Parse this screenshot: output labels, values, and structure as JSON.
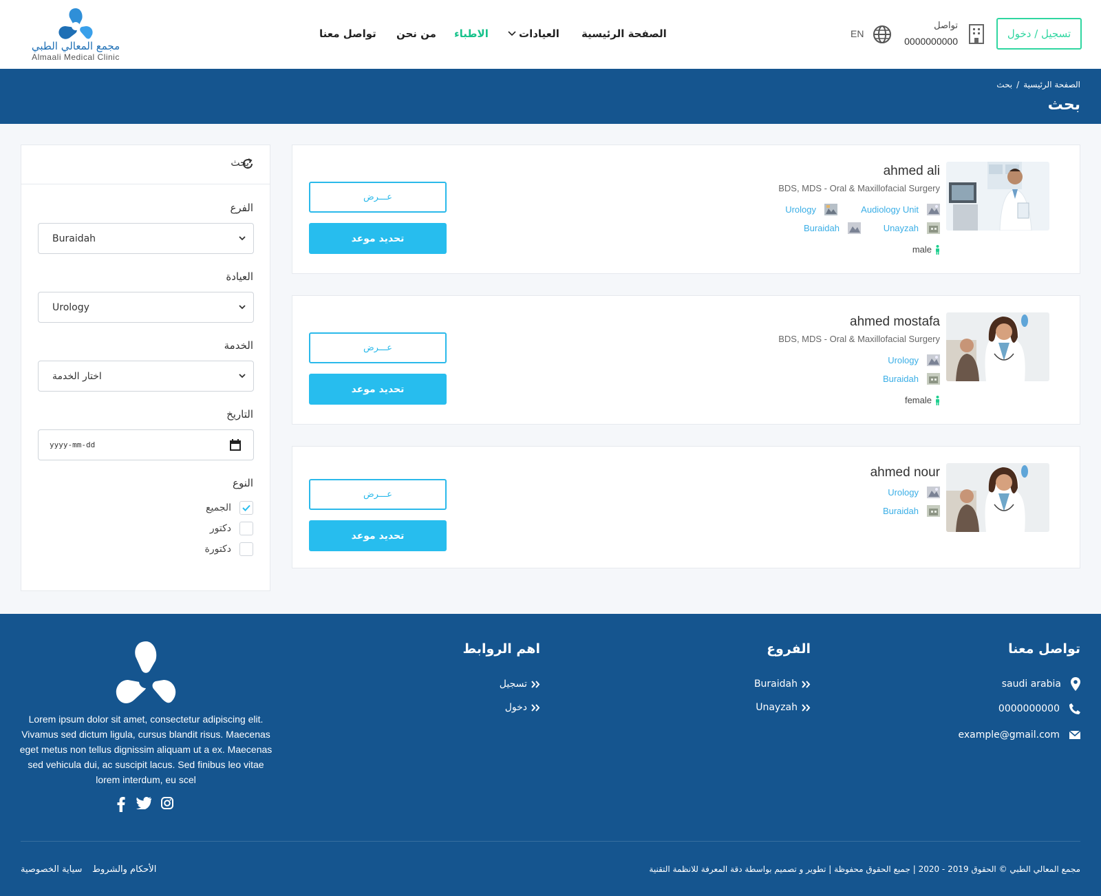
{
  "header": {
    "logo_ar": "مجمع المعالي الطبي",
    "logo_en": "Almaali Medical Clinic",
    "nav": [
      {
        "label": "الصفحة الرئيسية",
        "active": false
      },
      {
        "label": "العيادات",
        "active": false
      },
      {
        "label": "الاطباء",
        "active": true
      },
      {
        "label": "من نحن",
        "active": false
      },
      {
        "label": "تواصل معنا",
        "active": false
      }
    ],
    "login_label": "تسجيل / دخول",
    "contact_label": "تواصل",
    "contact_phone": "0000000000",
    "lang_label": "EN",
    "accent_color": "#2fd6a0",
    "active_nav_color": "#16c28b"
  },
  "banner": {
    "breadcrumb_home": "الصفحة الرئيسية",
    "breadcrumb_sep": "/",
    "breadcrumb_current": "بحث",
    "title": "بحث",
    "color": "#15558f"
  },
  "sidebar": {
    "title": "بحث",
    "branch_label": "الفرع",
    "branch_value": "Buraidah",
    "clinic_label": "العيادة",
    "clinic_value": "Urology",
    "service_label": "الخدمة",
    "service_value": "اختار الخدمة",
    "date_label": "التاريخ",
    "date_placeholder": "yyyy-mm-dd",
    "type_label": "النوع",
    "type_options": [
      {
        "label": "الجميع",
        "checked": true
      },
      {
        "label": "دكتور",
        "checked": false
      },
      {
        "label": "دكتورة",
        "checked": false
      }
    ]
  },
  "doctors": [
    {
      "name": "ahmed ali",
      "qualification": "BDS, MDS - Oral & Maxillofacial Surgery",
      "clinics": [
        "Audiology Unit",
        "Urology"
      ],
      "branches": [
        "Unayzah",
        "Buraidah"
      ],
      "gender": "male",
      "view_label": "عـــرض",
      "book_label": "تحديد موعد"
    },
    {
      "name": "ahmed mostafa",
      "qualification": "BDS, MDS - Oral & Maxillofacial Surgery",
      "clinics": [
        "Urology"
      ],
      "branches": [
        "Buraidah"
      ],
      "gender": "female",
      "view_label": "عـــرض",
      "book_label": "تحديد موعد"
    },
    {
      "name": "ahmed nour",
      "qualification": "",
      "clinics": [
        "Urology"
      ],
      "branches": [
        "Buraidah"
      ],
      "gender": "",
      "view_label": "عـــرض",
      "book_label": "تحديد موعد"
    }
  ],
  "footer": {
    "contact_title": "تواصل معنا",
    "address": "saudi arabia",
    "phone": "0000000000",
    "email": "example@gmail.com",
    "branches_title": "الفروع",
    "branches": [
      "Buraidah",
      "Unayzah"
    ],
    "links_title": "اهم الروابط",
    "links": [
      "تسجيل",
      "دخول"
    ],
    "description": "Lorem ipsum dolor sit amet, consectetur adipiscing elit. Vivamus sed dictum ligula, cursus blandit risus. Maecenas eget metus non tellus dignissim aliquam ut a ex. Maecenas sed vehicula dui, ac suscipit lacus. Sed finibus leo vitae lorem interdum, eu scel",
    "copyright": "مجمع المعالي الطبي © الحقوق 2019 - 2020 | جميع الحقوق محفوظة | تطوير و تصميم بواسطة دقة المعرفة للانظمة التقنية",
    "terms_label": "الأحكام والشروط",
    "privacy_label": "سياية الخصوصية"
  }
}
